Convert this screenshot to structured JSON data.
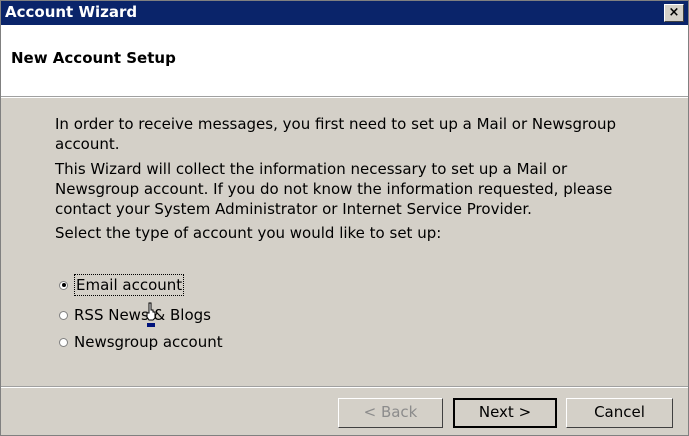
{
  "window": {
    "title": "Account Wizard",
    "close_label": "×"
  },
  "header": {
    "title": "New Account Setup"
  },
  "content": {
    "paragraph1": "In order to receive messages, you first need to set up a Mail or Newsgroup account.",
    "paragraph2": "This Wizard will collect the information necessary to set up a Mail or Newsgroup account. If you do not know the information requested, please contact your System Administrator or Internet Service Provider.",
    "paragraph3": "Select the type of account you would like to set up:"
  },
  "options": [
    {
      "label": "Email account",
      "selected": true
    },
    {
      "label": "RSS News & Blogs",
      "selected": false
    },
    {
      "label": "Newsgroup account",
      "selected": false
    }
  ],
  "buttons": {
    "back": "< Back",
    "next": "Next >",
    "cancel": "Cancel"
  }
}
